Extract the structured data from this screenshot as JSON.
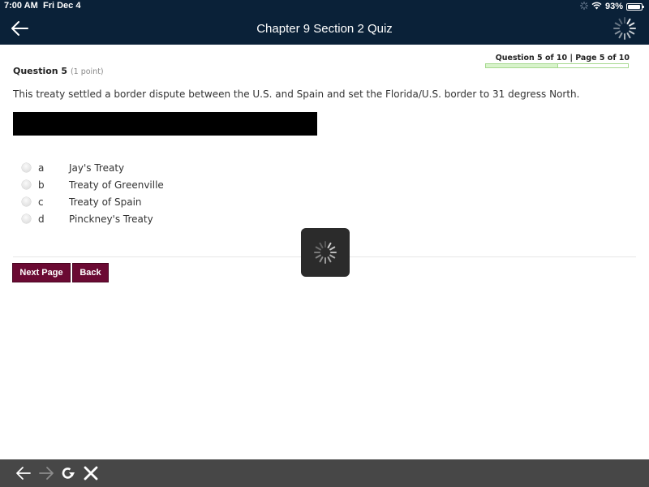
{
  "status_bar": {
    "time": "7:00 AM",
    "date": "Fri Dec 4",
    "battery_percent": "93%",
    "battery_level": 0.93,
    "icons": [
      "activity-spinner-icon",
      "wifi-icon",
      "battery-icon"
    ]
  },
  "header": {
    "title": "Chapter 9 Section 2 Quiz",
    "back_icon": "arrow-left-icon",
    "loading_icon": "spinner-icon",
    "background_color": "#0a2138"
  },
  "quiz": {
    "question_label": "Question 5",
    "points": "(1 point)",
    "progress_text": "Question 5 of 10 | Page 5 of 10",
    "progress_fraction": 0.5,
    "question_text": "This treaty settled a border dispute between the U.S. and Spain and set the Florida/U.S. border to 31 degress North.",
    "options": [
      {
        "letter": "a",
        "text": "Jay's Treaty"
      },
      {
        "letter": "b",
        "text": "Treaty of Greenville"
      },
      {
        "letter": "c",
        "text": "Treaty of Spain"
      },
      {
        "letter": "d",
        "text": "Pinckney's Treaty"
      }
    ]
  },
  "buttons": {
    "next_page": "Next Page",
    "back": "Back",
    "color": "#6b0a33"
  },
  "overlay": {
    "loading_icon": "spinner-icon"
  },
  "bottom_toolbar": {
    "icons": [
      "arrow-left-icon",
      "arrow-right-icon",
      "refresh-icon",
      "close-icon"
    ]
  }
}
